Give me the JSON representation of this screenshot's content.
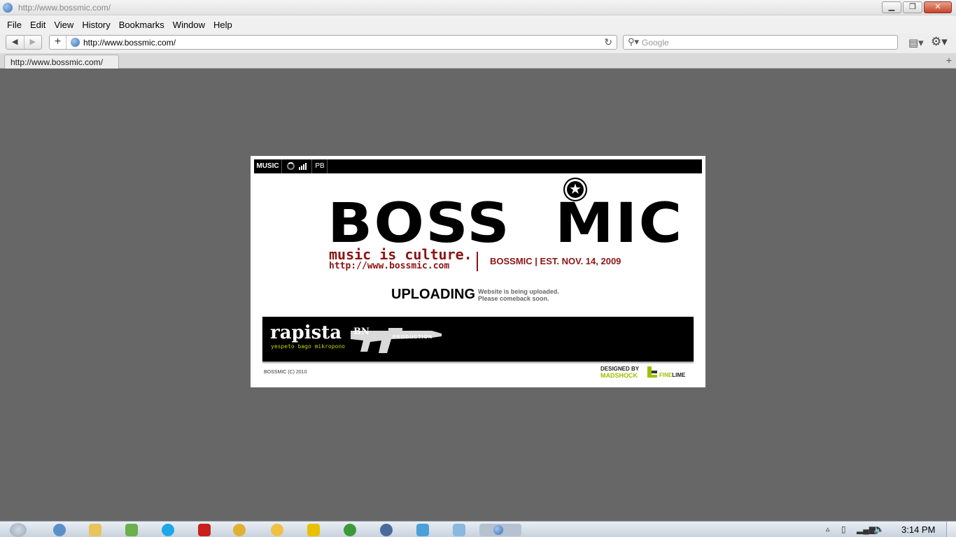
{
  "window": {
    "title": "http://www.bossmic.com/"
  },
  "menu": [
    "File",
    "Edit",
    "View",
    "History",
    "Bookmarks",
    "Window",
    "Help"
  ],
  "toolbar": {
    "back": "◀",
    "forward": "▶",
    "new_tab": "+",
    "url": "http://www.bossmic.com/",
    "reload": "↻",
    "search_placeholder": "Google"
  },
  "tabs": [
    {
      "label": "http://www.bossmic.com/"
    }
  ],
  "site": {
    "nav": {
      "music": "MUSIC",
      "pb": "PB"
    },
    "logo": "BOSS  MIC",
    "tagline": "music is culture.",
    "url_text": "http://www.bossmic.com",
    "est": "BOSSMIC  |  EST. NOV. 14, 2009",
    "uploading": "UPLOADING",
    "upload_note_1": "Website is being uploaded.",
    "upload_note_2": "Please comeback soon.",
    "banner": {
      "rapista": "rapista",
      "rapista_sub": "yespeto bago mikropono",
      "gun_label": "BN",
      "gun_prod": "PRODUCTION"
    },
    "copyright": "BOSSMIC (C) 2010",
    "designed_by": "DESIGNED BY",
    "designer": "MADSHOCK",
    "fine": "FINE",
    "lime": "LIME"
  },
  "taskbar": {
    "clock": "3:14 PM"
  },
  "colors": {
    "brand_red": "#8b1414",
    "lime": "#9cc000"
  }
}
